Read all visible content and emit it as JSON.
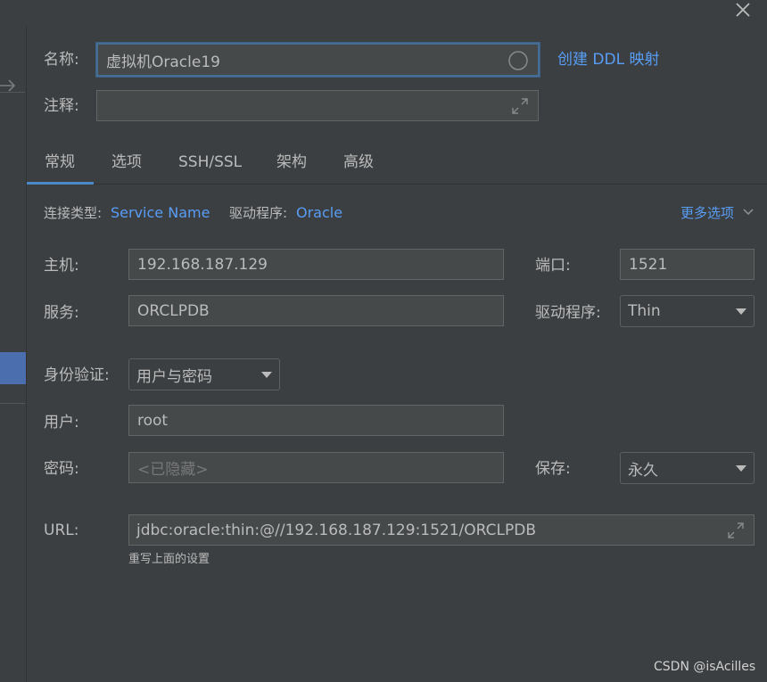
{
  "header": {
    "name_label": "名称:",
    "name_value": "虚拟机Oracle19",
    "create_ddl_link": "创建 DDL 映射",
    "comment_label": "注释:",
    "comment_value": ""
  },
  "tabs": [
    {
      "label": "常规",
      "active": true
    },
    {
      "label": "选项"
    },
    {
      "label": "SSH/SSL"
    },
    {
      "label": "架构"
    },
    {
      "label": "高级"
    }
  ],
  "connection": {
    "type_label": "连接类型:",
    "type_value": "Service Name",
    "driver_label": "驱动程序:",
    "driver_value": "Oracle",
    "more_options": "更多选项"
  },
  "form": {
    "host_label": "主机:",
    "host_value": "192.168.187.129",
    "port_label": "端口:",
    "port_value": "1521",
    "service_label": "服务:",
    "service_value": "ORCLPDB",
    "driver_label": "驱动程序:",
    "driver_value": "Thin",
    "auth_label": "身份验证:",
    "auth_value": "用户与密码",
    "user_label": "用户:",
    "user_value": "root",
    "password_label": "密码:",
    "password_placeholder": "<已隐藏>",
    "save_label": "保存:",
    "save_value": "永久",
    "url_label": "URL:",
    "url_value": "jdbc:oracle:thin:@//192.168.187.129:1521/ORCLPDB",
    "override_note": "重写上面的设置"
  },
  "watermark": "CSDN @isAcilles",
  "colors": {
    "background": "#3c3f41",
    "field_bg": "#45494a",
    "text": "#bbbbbb",
    "link": "#589df6",
    "focus_border": "#466d94",
    "tab_underline": "#4a88c7",
    "selection": "#4b6eaf"
  },
  "icons": [
    "close-icon",
    "arrow-right-icon",
    "spinner-circle-icon",
    "expand-icon",
    "chevron-down-icon",
    "dropdown-caret-icon"
  ]
}
